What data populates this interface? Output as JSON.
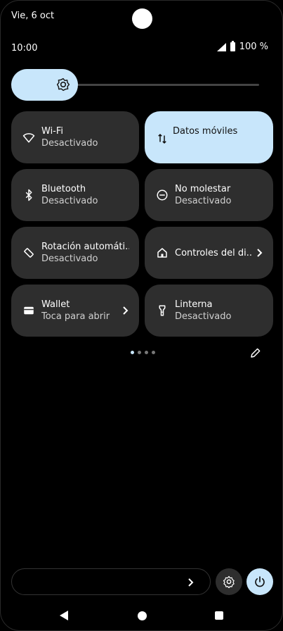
{
  "status_bar": {
    "date": "Vie, 6 oct",
    "time": "10:00",
    "battery": "100 %"
  },
  "brightness": {
    "level": 0.0,
    "icon": "brightness-icon"
  },
  "tiles": [
    {
      "id": "wifi",
      "title": "Wi-Fi",
      "subtitle": "Desactivado",
      "icon": "wifi-icon",
      "active": false
    },
    {
      "id": "mobile-data",
      "title": "Datos móviles",
      "subtitle": "",
      "icon": "mobile-data-icon",
      "active": true
    },
    {
      "id": "bluetooth",
      "title": "Bluetooth",
      "subtitle": "Desactivado",
      "icon": "bluetooth-icon",
      "active": false
    },
    {
      "id": "dnd",
      "title": "No molestar",
      "subtitle": "Desactivado",
      "icon": "do-not-disturb-icon",
      "active": false
    },
    {
      "id": "rotation",
      "title": "Rotación automáti..",
      "subtitle": "Desactivado",
      "icon": "auto-rotate-icon",
      "active": false
    },
    {
      "id": "device-controls",
      "title": "Controles del di..",
      "subtitle": "",
      "icon": "home-icon",
      "active": false
    },
    {
      "id": "wallet",
      "title": "Wallet",
      "subtitle": "Toca para abrir",
      "icon": "wallet-icon",
      "active": false
    },
    {
      "id": "flashlight",
      "title": "Linterna",
      "subtitle": "Desactivado",
      "icon": "flashlight-icon",
      "active": false
    }
  ],
  "pager": {
    "pages": 4,
    "current": 1
  },
  "colors": {
    "accent": "#c8e6fb",
    "tile_bg": "#2e2e2e",
    "background": "#000000"
  }
}
